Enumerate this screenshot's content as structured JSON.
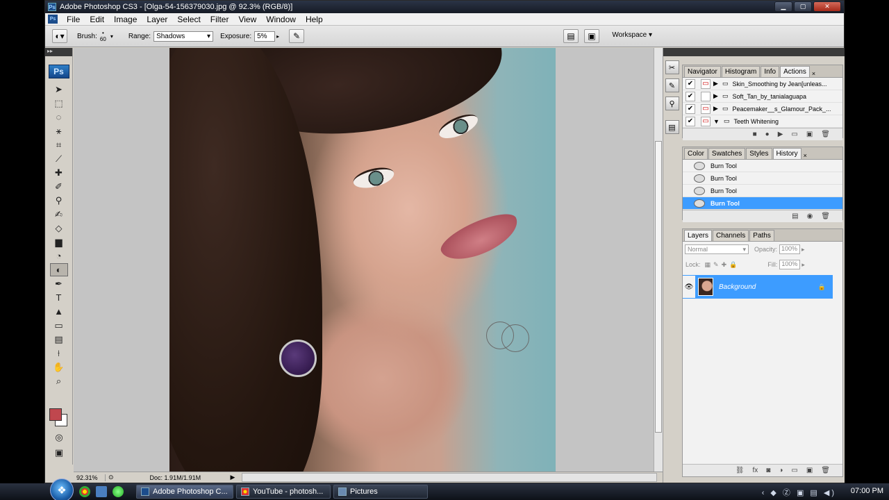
{
  "window": {
    "title": "Adobe Photoshop CS3 - [Olga-54-156379030.jpg @ 92.3% (RGB/8)]",
    "app_icon": "Ps",
    "controls": [
      "minimize-icon",
      "maximize-icon",
      "close-icon"
    ]
  },
  "menu": {
    "app_icon": "Ps",
    "items": [
      "File",
      "Edit",
      "Image",
      "Layer",
      "Select",
      "Filter",
      "View",
      "Window",
      "Help"
    ]
  },
  "options": {
    "brush_label": "Brush:",
    "brush_size": "60",
    "range_label": "Range:",
    "range_value": "Shadows",
    "exposure_label": "Exposure:",
    "exposure_value": "5%",
    "workspace_label": "Workspace ▾"
  },
  "toolbox": {
    "logo": "Ps",
    "tools": [
      "move-tool",
      "marquee-tool",
      "lasso-tool",
      "magic-wand-tool",
      "crop-tool",
      "slice-tool",
      "healing-brush-tool",
      "brush-tool",
      "clone-stamp-tool",
      "history-brush-tool",
      "eraser-tool",
      "gradient-tool",
      "blur-tool",
      "burn-tool",
      "pen-tool",
      "type-tool",
      "path-selection-tool",
      "shape-tool",
      "notes-tool",
      "eyedropper-tool",
      "hand-tool",
      "zoom-tool"
    ],
    "active_tool": "burn-tool",
    "foreground_color": "#c0474e",
    "background_color": "#ffffff"
  },
  "status": {
    "zoom": "92.31%",
    "doc": "Doc: 1.91M/1.91M"
  },
  "actions_panel": {
    "tabs": [
      "Navigator",
      "Histogram",
      "Info",
      "Actions"
    ],
    "active_tab": "Actions",
    "items": [
      "Skin_Smoothing by Jean[unleas...",
      "Soft_Tan_by_tanialaguapa",
      "Peacemaker__s_Glamour_Pack_...",
      "Teeth Whitening"
    ]
  },
  "history_panel": {
    "tabs": [
      "Color",
      "Swatches",
      "Styles",
      "History"
    ],
    "active_tab": "History",
    "items": [
      "Burn Tool",
      "Burn Tool",
      "Burn Tool",
      "Burn Tool"
    ],
    "selected_index": 3
  },
  "layers_panel": {
    "tabs": [
      "Layers",
      "Channels",
      "Paths"
    ],
    "active_tab": "Layers",
    "blend_mode": "Normal",
    "opacity_label": "Opacity:",
    "opacity": "100%",
    "lock_label": "Lock:",
    "fill_label": "Fill:",
    "fill": "100%",
    "layer_name": "Background"
  },
  "taskbar": {
    "buttons": [
      "Adobe Photoshop C...",
      "YouTube - photosh...",
      "Pictures"
    ],
    "clock": "07:00 PM"
  },
  "colors": {
    "selection": "#3d9cff",
    "panel_bg": "#d4d0c8"
  }
}
